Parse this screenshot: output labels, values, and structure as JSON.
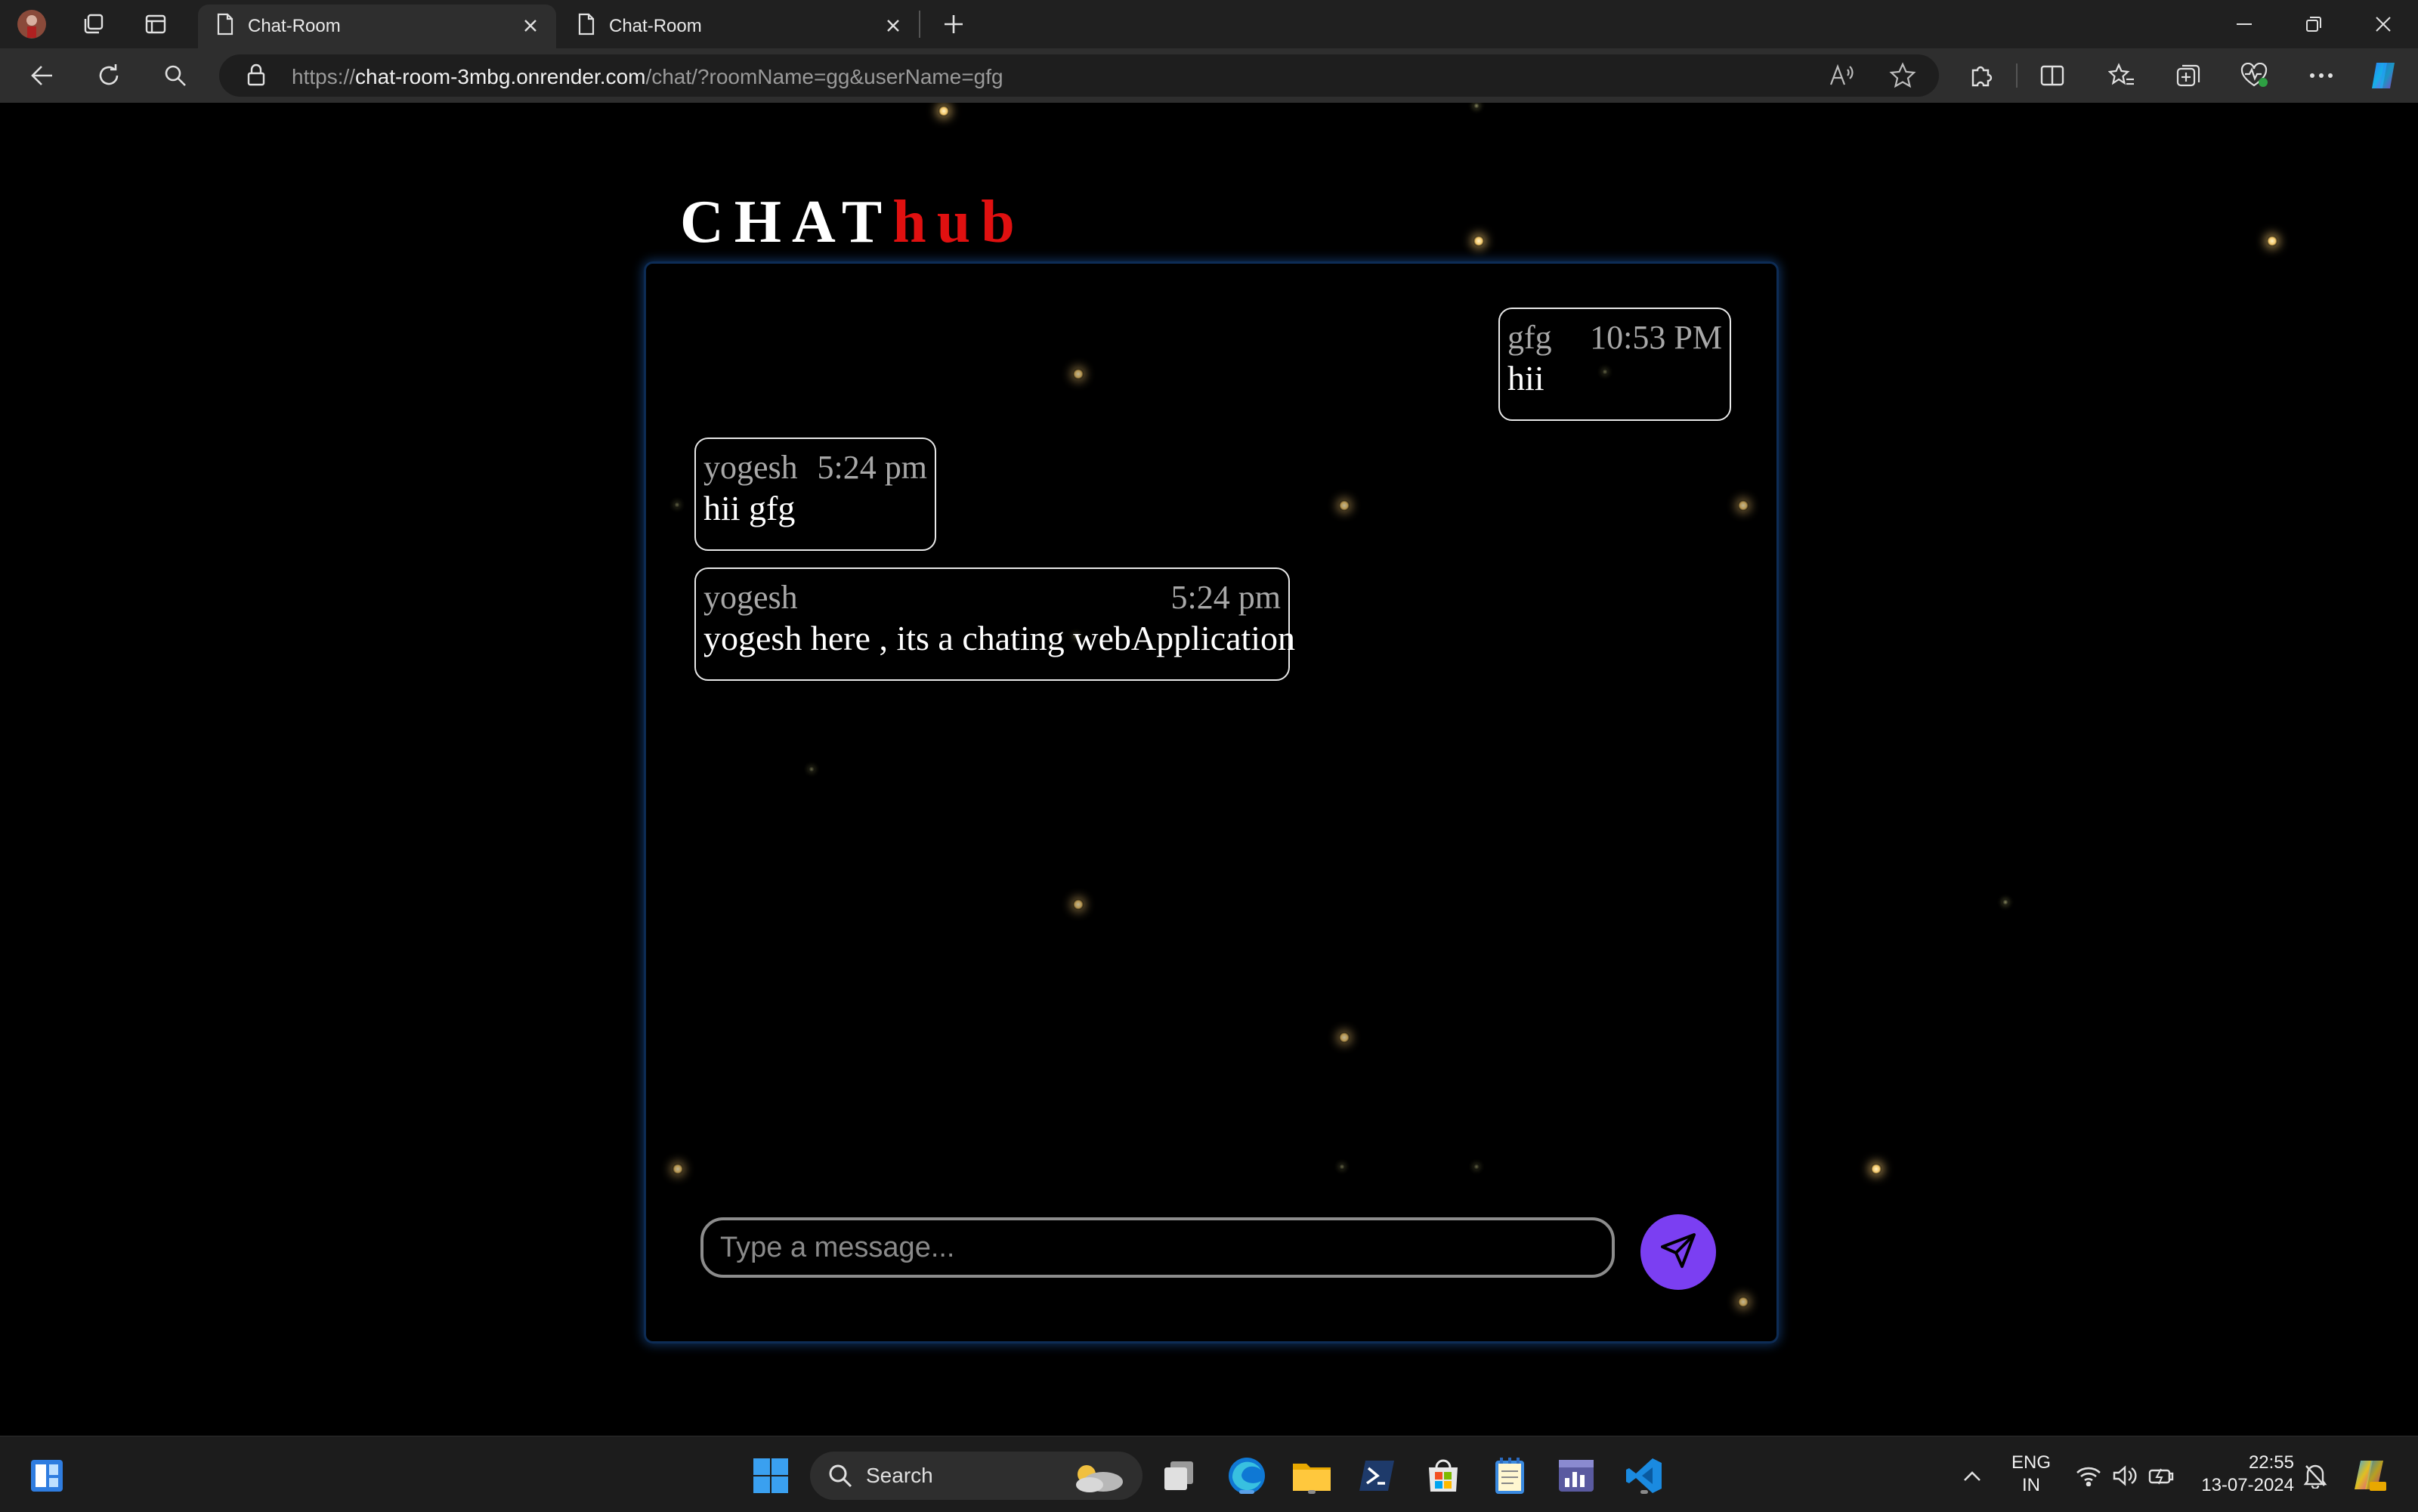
{
  "browser": {
    "tabs": [
      {
        "label": "Chat-Room",
        "active": true
      },
      {
        "label": "Chat-Room",
        "active": false
      }
    ],
    "url_scheme": "https://",
    "url_host": "chat-room-3mbg.onrender.com",
    "url_path": "/chat/?roomName=gg&userName=gfg"
  },
  "page": {
    "brand_primary": "CHAT",
    "brand_accent": "hub",
    "brand_accent_color": "#e01010",
    "messages": [
      {
        "user": "gfg",
        "time": "10:53 PM",
        "text": "hii",
        "side": "right"
      },
      {
        "user": "yogesh",
        "time": "5:24 pm",
        "text": "hii gfg",
        "side": "left"
      },
      {
        "user": "yogesh",
        "time": "5:24 pm",
        "text": "yogesh here , its a chating webApplication",
        "side": "left"
      }
    ],
    "input_placeholder": "Type a message...",
    "send_icon": "paper-plane-icon",
    "send_color": "#7b3ff2"
  },
  "taskbar": {
    "search_label": "Search",
    "lang_top": "ENG",
    "lang_bottom": "IN",
    "time": "22:55",
    "date": "13-07-2024"
  }
}
